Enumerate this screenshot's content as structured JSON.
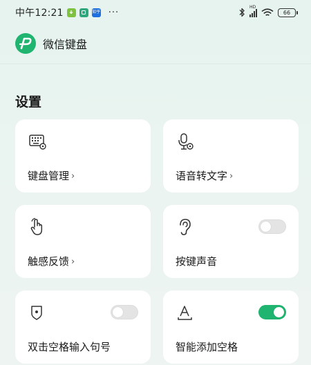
{
  "status_bar": {
    "time": "中午12:21",
    "app_badges": [
      "",
      "",
      "知乎"
    ],
    "dots": "···",
    "network": "HD",
    "battery": "66"
  },
  "header": {
    "title": "微信键盘"
  },
  "settings": {
    "section_title": "设置",
    "cards": [
      {
        "label": "键盘管理",
        "chevron": "›",
        "icon": "keyboard-settings-icon"
      },
      {
        "label": "语音转文字",
        "chevron": "›",
        "icon": "microphone-settings-icon"
      },
      {
        "label": "触感反馈",
        "chevron": "›",
        "icon": "touch-hand-icon"
      },
      {
        "label": "按键声音",
        "icon": "ear-icon",
        "toggle_on": false
      },
      {
        "label": "双击空格输入句号",
        "icon": "shield-dot-icon",
        "toggle_on": false
      },
      {
        "label": "智能添加空格",
        "icon": "text-space-icon",
        "toggle_on": true
      }
    ]
  },
  "colors": {
    "accent": "#1fb571",
    "background": "#e8f4ef",
    "card": "#ffffff"
  }
}
